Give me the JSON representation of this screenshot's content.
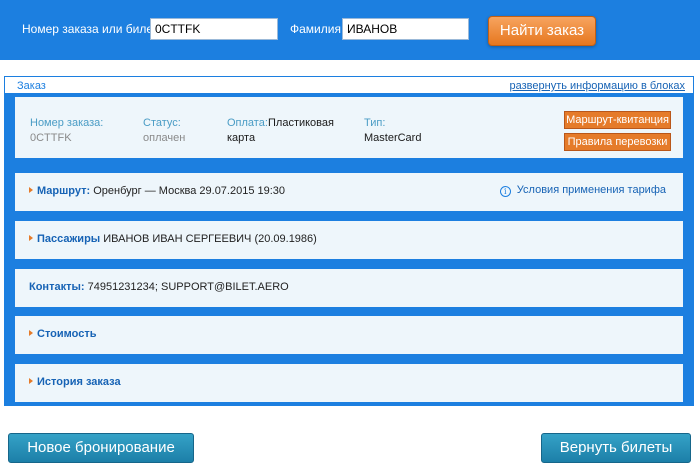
{
  "search": {
    "order_label": "Номер заказа или билета",
    "order_value": "0CTTFK",
    "surname_label": "Фамилия",
    "surname_value": "ИВАНОВ",
    "find_button": "Найти заказ"
  },
  "order_block": {
    "title": "Заказ",
    "expand_link": "развернуть информацию в блоках",
    "fields": {
      "number_label": "Номер заказа:",
      "number_value": "0CTTFK",
      "status_label": "Статус:",
      "status_value": "оплачен",
      "payment_label": "Оплата:",
      "payment_value_1": "Пластиковая",
      "payment_value_2": "карта",
      "type_label": "Тип:",
      "type_value": "MasterCard"
    },
    "buttons": {
      "receipt": "Маршрут-квитанция",
      "rules": "Правила перевозки"
    },
    "route": {
      "key": "Маршрут:",
      "value": " Оренбург — Москва 29.07.2015 19:30",
      "tariff_link": "Условия применения тарифа"
    },
    "passengers": {
      "key": "Пассажиры",
      "value": " ИВАНОВ ИВАН СЕРГЕЕВИЧ (20.09.1986)"
    },
    "contacts": {
      "key": "Контакты:",
      "value": " 74951231234; SUPPORT@BILET.AERO"
    },
    "cost": {
      "key": "Стоимость"
    },
    "history": {
      "key": "История заказа"
    }
  },
  "bottom": {
    "new_booking": "Новое бронирование",
    "return_tickets": "Вернуть билеты"
  },
  "colors": {
    "primary_blue": "#1c7fe0",
    "accent_orange": "#e57b2a",
    "panel_bg": "#eef6fb"
  },
  "icons": {
    "arrow": "triangle-right-icon",
    "info": "info-circle-icon"
  }
}
